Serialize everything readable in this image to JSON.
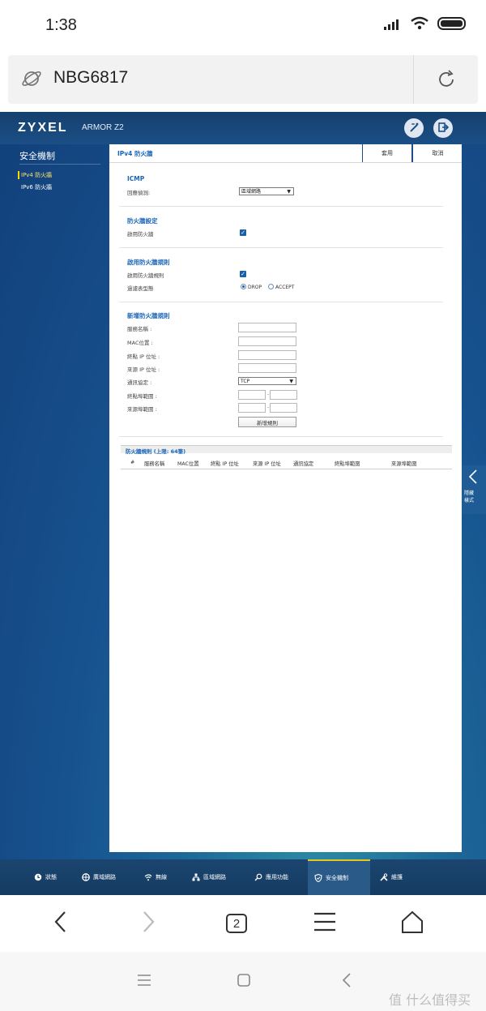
{
  "status_bar": {
    "time": "1:38"
  },
  "browser": {
    "url": "NBG6817",
    "tab_count": "2"
  },
  "router": {
    "brand": "ZYXEL",
    "model": "ARMOR Z2",
    "sidebar": {
      "title": "安全機制",
      "items": [
        {
          "label": "IPv4 防火牆",
          "active": true
        },
        {
          "label": "IPv6 防火牆",
          "active": false
        }
      ]
    },
    "panel": {
      "title": "IPv4 防火牆",
      "apply_label": "套用",
      "cancel_label": "取消",
      "icmp": {
        "title": "ICMP",
        "ping_label": "回應偵測:",
        "ping_value": "區域網路"
      },
      "firewall_setup": {
        "title": "防火牆設定",
        "enable_label": "啟用防火牆"
      },
      "rules_enable": {
        "title": "啟用防火牆規則",
        "enable_label": "啟用防火牆規則",
        "filter_label": "過濾表型態",
        "options": [
          "DROP",
          "ACCEPT"
        ]
      },
      "add_rule": {
        "title": "新增防火牆規則",
        "service_name": "服務名稱 :",
        "mac": "MAC位置 :",
        "dest_ip": "終點 IP 位址 :",
        "src_ip": "來源 IP 位址 :",
        "protocol": "通訊協定 :",
        "protocol_value": "TCP",
        "dest_port": "終點埠範圍 :",
        "src_port": "來源埠範圍 :",
        "add_button": "新增規則"
      },
      "rules_table": {
        "title": "防火牆規則 (上限: 64筆)",
        "columns": [
          "#",
          "服務名稱",
          "MAC位置",
          "終點 IP 位址",
          "來源 IP 位址",
          "通訊協定",
          "終點埠範圍",
          "來源埠範圍"
        ]
      }
    },
    "right_tab": {
      "line1": "隱藏",
      "line2": "樣式"
    },
    "nav": [
      {
        "label": "狀態",
        "icon": "status-icon"
      },
      {
        "label": "廣域網路",
        "icon": "globe-icon"
      },
      {
        "label": "無線",
        "icon": "wifi-icon"
      },
      {
        "label": "區域網路",
        "icon": "lan-icon"
      },
      {
        "label": "應用功能",
        "icon": "app-icon"
      },
      {
        "label": "安全機制",
        "icon": "shield-icon",
        "active": true
      },
      {
        "label": "維護",
        "icon": "tools-icon"
      }
    ]
  },
  "watermark": "值 什么值得买",
  "colors": {
    "accent": "#1a66b7",
    "nav_active": "#e7c51a",
    "header_bg": "#15406e"
  }
}
